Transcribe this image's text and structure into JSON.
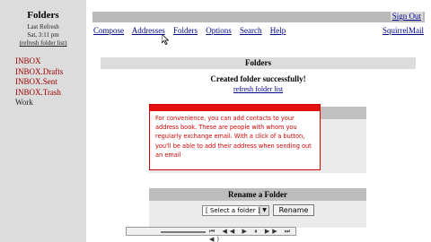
{
  "sidebar": {
    "title": "Folders",
    "last_refresh_label": "Last Refresh",
    "refresh_time": "Sat, 3:11 pm",
    "refresh_link": "(refresh folder list)",
    "folders": [
      {
        "label": "INBOX"
      },
      {
        "label": "INBOX.Drafts"
      },
      {
        "label": "INBOX.Sent"
      },
      {
        "label": "INBOX.Trash"
      },
      {
        "label": "Work"
      }
    ]
  },
  "header": {
    "sign_out": "Sign Out",
    "nav": [
      "Compose",
      "Addresses",
      "Folders",
      "Options",
      "Search",
      "Help"
    ],
    "brand_link": "SquirrelMail"
  },
  "main": {
    "section_title": "Folders",
    "status_message": "Created folder successfully!",
    "refresh_link": "refresh folder list",
    "tooltip_text": "For convenience, you can add contacts to your address book. These are people with whom you regularly exchange email. With a click of a button, you'll be able to add their address when sending out an email",
    "rename": {
      "title": "Rename a Folder",
      "select_value": "[ Select a folder ]",
      "button_label": "Rename"
    }
  },
  "player": {
    "controls": "⏮ ◀◀ ▶ ⏸ ▶▶ ⏭ ◀)"
  },
  "colors": {
    "link": "#00008b",
    "folder": "#a00000",
    "tooltip_accent": "#e41010"
  }
}
